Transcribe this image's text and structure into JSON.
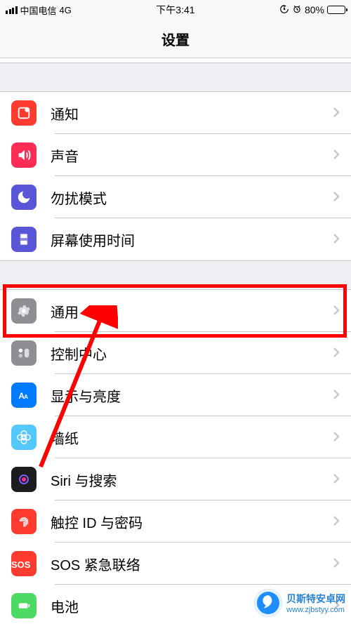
{
  "status": {
    "carrier": "中国电信",
    "network": "4G",
    "time": "下午3:41",
    "battery_pct": "80%",
    "icons": {
      "lock": "⊕",
      "alarm": "⏰"
    }
  },
  "nav": {
    "title": "设置"
  },
  "groups": [
    {
      "rows": [
        {
          "key": "truncated",
          "label": "",
          "color": "#4CD964",
          "icon_svg": ""
        }
      ]
    },
    {
      "rows": [
        {
          "key": "notifications",
          "label": "通知",
          "color": "#FF3B30"
        },
        {
          "key": "sounds",
          "label": "声音",
          "color": "#FF2D55"
        },
        {
          "key": "dnd",
          "label": "勿扰模式",
          "color": "#5856D6"
        },
        {
          "key": "screentime",
          "label": "屏幕使用时间",
          "color": "#5856D6"
        }
      ]
    },
    {
      "rows": [
        {
          "key": "general",
          "label": "通用",
          "color": "#8E8E93"
        },
        {
          "key": "controlcenter",
          "label": "控制中心",
          "color": "#8E8E93"
        },
        {
          "key": "display",
          "label": "显示与亮度",
          "color": "#007AFF"
        },
        {
          "key": "wallpaper",
          "label": "墙纸",
          "color": "#54C7FC"
        },
        {
          "key": "siri",
          "label": "Siri 与搜索",
          "color": "#1C1C1E"
        },
        {
          "key": "touchid",
          "label": "触控 ID 与密码",
          "color": "#FF3B30"
        },
        {
          "key": "sos",
          "label": "SOS 紧急联络",
          "color": "#FF3B30"
        },
        {
          "key": "battery",
          "label": "电池",
          "color": "#4CD964"
        }
      ]
    }
  ],
  "watermark": {
    "site": "贝斯特安卓网",
    "url": "www.zjbstyy.com"
  },
  "highlight_row_key": "general"
}
